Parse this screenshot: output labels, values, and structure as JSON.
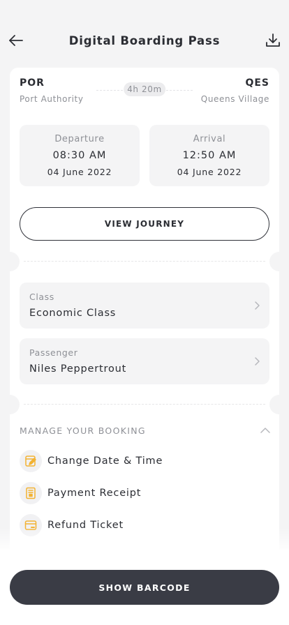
{
  "header": {
    "title": "Digital Boarding Pass",
    "back_icon": "arrow-left-icon",
    "download_icon": "download-icon"
  },
  "route": {
    "origin_code": "POR",
    "origin_city": "Port Authority",
    "destination_code": "QES",
    "destination_city": "Queens Village",
    "duration": "4h 20m"
  },
  "departure": {
    "label": "Departure",
    "time": "08:30 AM",
    "date": "04 June 2022"
  },
  "arrival": {
    "label": "Arrival",
    "time": "12:50 AM",
    "date": "04 June 2022"
  },
  "view_journey_label": "VIEW JOURNEY",
  "class_info": {
    "label": "Class",
    "value": "Economic Class"
  },
  "passenger": {
    "label": "Passenger",
    "value": "Niles Peppertrout"
  },
  "manage": {
    "title": "MANAGE YOUR BOOKING",
    "items": [
      {
        "label": "Change Date & Time",
        "icon": "edit-calendar-icon"
      },
      {
        "label": "Payment Receipt",
        "icon": "receipt-icon"
      },
      {
        "label": "Refund Ticket",
        "icon": "refund-card-icon"
      }
    ]
  },
  "show_barcode_label": "SHOW BARCODE",
  "colors": {
    "accent": "#f2b233",
    "primary_dark": "#3a3c45",
    "background": "#f4f4f5",
    "muted_text": "#8e9096"
  }
}
